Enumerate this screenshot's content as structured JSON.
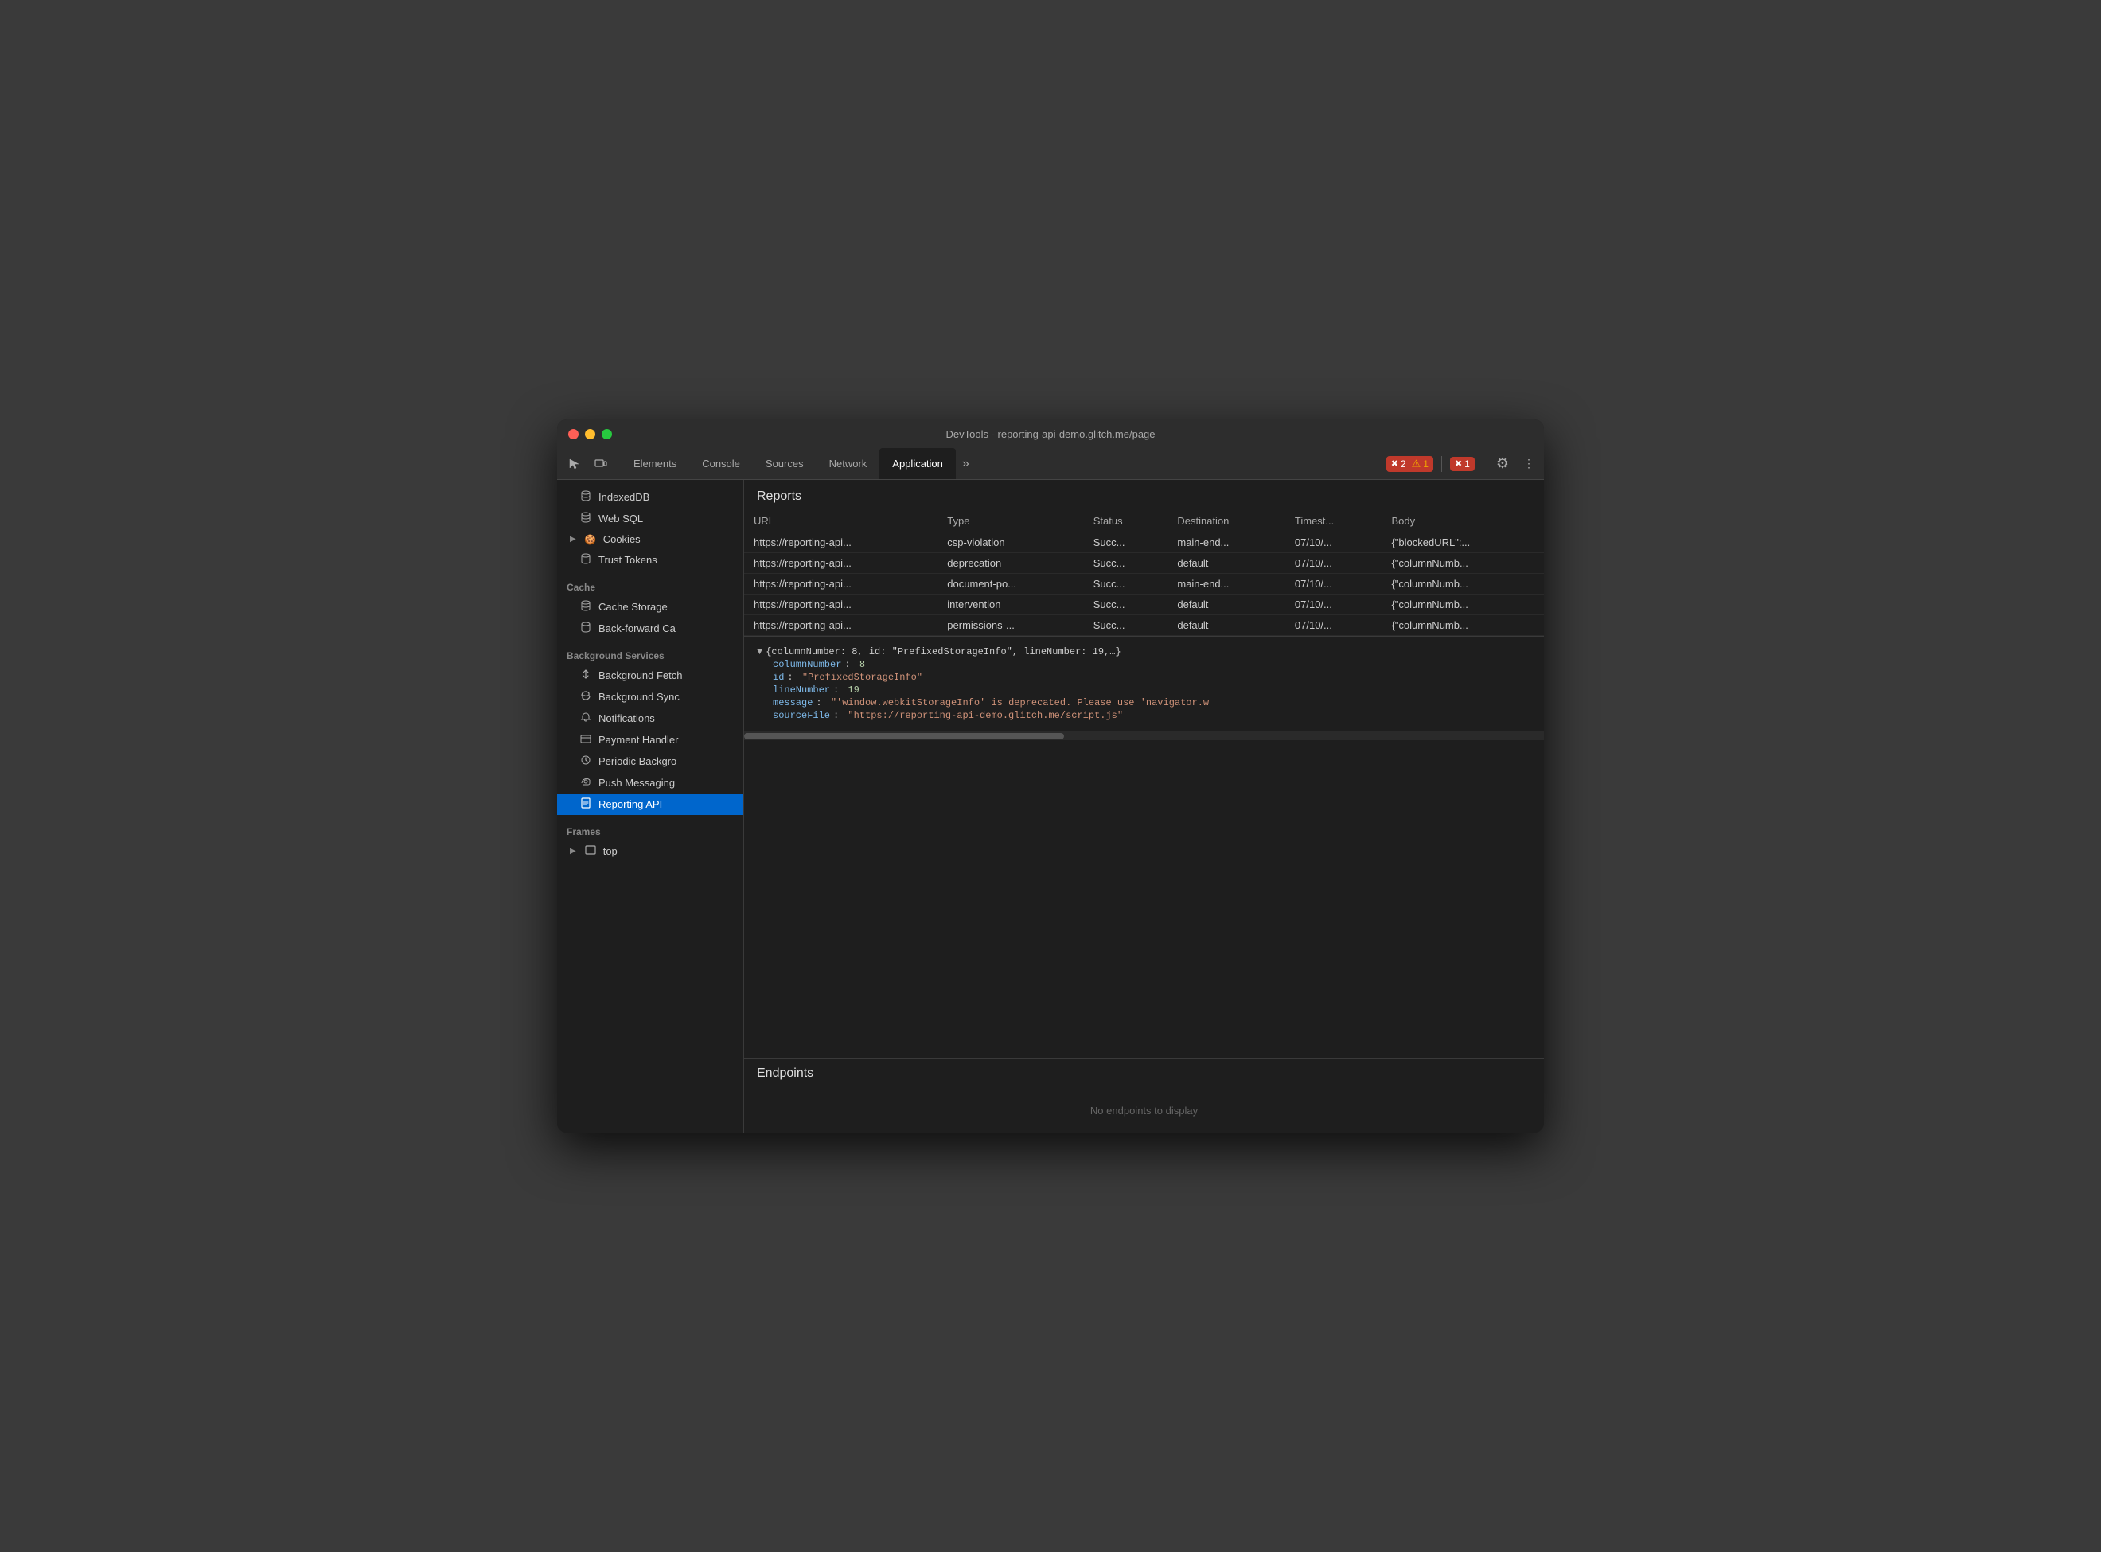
{
  "window": {
    "title": "DevTools - reporting-api-demo.glitch.me/page"
  },
  "tabs": [
    {
      "label": "Elements",
      "active": false
    },
    {
      "label": "Console",
      "active": false
    },
    {
      "label": "Sources",
      "active": false
    },
    {
      "label": "Network",
      "active": false
    },
    {
      "label": "Application",
      "active": true
    }
  ],
  "badges": {
    "error_count": "2",
    "warn_count": "1",
    "violation_count": "1"
  },
  "sidebar": {
    "sections": [
      {
        "name": "",
        "items": [
          {
            "label": "IndexedDB",
            "icon": "🗃",
            "active": false,
            "indent": true
          },
          {
            "label": "Web SQL",
            "icon": "🗃",
            "active": false,
            "indent": true
          },
          {
            "label": "Cookies",
            "icon": "🍪",
            "active": false,
            "indent": false,
            "hasChevron": true
          },
          {
            "label": "Trust Tokens",
            "icon": "🗃",
            "active": false,
            "indent": true
          }
        ]
      },
      {
        "name": "Cache",
        "items": [
          {
            "label": "Cache Storage",
            "icon": "🗃",
            "active": false,
            "indent": true
          },
          {
            "label": "Back-forward Ca",
            "icon": "🗃",
            "active": false,
            "indent": true
          }
        ]
      },
      {
        "name": "Background Services",
        "items": [
          {
            "label": "Background Fetch",
            "icon": "↕",
            "active": false,
            "indent": true
          },
          {
            "label": "Background Sync",
            "icon": "↻",
            "active": false,
            "indent": true
          },
          {
            "label": "Notifications",
            "icon": "🔔",
            "active": false,
            "indent": true
          },
          {
            "label": "Payment Handler",
            "icon": "💳",
            "active": false,
            "indent": true
          },
          {
            "label": "Periodic Backgro",
            "icon": "🕐",
            "active": false,
            "indent": true
          },
          {
            "label": "Push Messaging",
            "icon": "☁",
            "active": false,
            "indent": true
          },
          {
            "label": "Reporting API",
            "icon": "📄",
            "active": true,
            "indent": true
          }
        ]
      },
      {
        "name": "Frames",
        "items": [
          {
            "label": "top",
            "icon": "▢",
            "active": false,
            "indent": false,
            "hasChevron": true
          }
        ]
      }
    ]
  },
  "reports": {
    "title": "Reports",
    "columns": [
      "URL",
      "Type",
      "Status",
      "Destination",
      "Timest...",
      "Body"
    ],
    "rows": [
      {
        "url": "https://reporting-api...",
        "type": "csp-violation",
        "status": "Succ...",
        "destination": "main-end...",
        "timestamp": "07/10/...",
        "body": "{\"blockedURL\":..."
      },
      {
        "url": "https://reporting-api...",
        "type": "deprecation",
        "status": "Succ...",
        "destination": "default",
        "timestamp": "07/10/...",
        "body": "{\"columnNumb..."
      },
      {
        "url": "https://reporting-api...",
        "type": "document-po...",
        "status": "Succ...",
        "destination": "main-end...",
        "timestamp": "07/10/...",
        "body": "{\"columnNumb..."
      },
      {
        "url": "https://reporting-api...",
        "type": "intervention",
        "status": "Succ...",
        "destination": "default",
        "timestamp": "07/10/...",
        "body": "{\"columnNumb..."
      },
      {
        "url": "https://reporting-api...",
        "type": "permissions-...",
        "status": "Succ...",
        "destination": "default",
        "timestamp": "07/10/...",
        "body": "{\"columnNumb..."
      }
    ]
  },
  "json_detail": {
    "summary": "{columnNumber: 8, id: \"PrefixedStorageInfo\", lineNumber: 19,…}",
    "fields": [
      {
        "key": "columnNumber",
        "value": "8",
        "type": "num"
      },
      {
        "key": "id",
        "value": "\"PrefixedStorageInfo\"",
        "type": "str"
      },
      {
        "key": "lineNumber",
        "value": "19",
        "type": "num"
      },
      {
        "key": "message",
        "value": "\"'window.webkitStorageInfo' is deprecated. Please use 'navigator.w",
        "type": "str"
      },
      {
        "key": "sourceFile",
        "value": "\"https://reporting-api-demo.glitch.me/script.js\"",
        "type": "str"
      }
    ]
  },
  "endpoints": {
    "title": "Endpoints",
    "empty_text": "No endpoints to display"
  }
}
